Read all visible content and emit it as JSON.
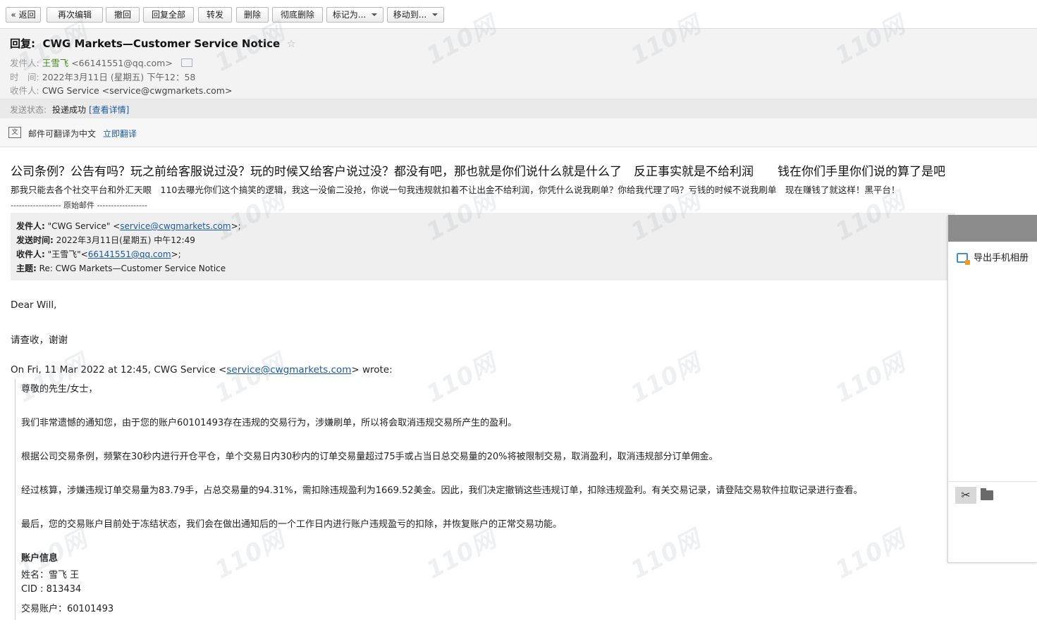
{
  "toolbar": {
    "back": "« 返回",
    "edit_again": "再次编辑",
    "recall": "撤回",
    "reply_all": "回复全部",
    "forward": "转发",
    "delete": "删除",
    "delete_permanent": "彻底删除",
    "mark_as": "标记为...",
    "move_to": "移动到..."
  },
  "header": {
    "reply_prefix": "回复:",
    "subject": "CWG Markets—Customer Service Notice",
    "star": "☆",
    "sender_label": "发件人:",
    "sender_name": "王雪飞",
    "sender_email": "<66141551@qq.com>",
    "time_label": "时　间:",
    "time_value": "2022年3月11日 (星期五) 下午12：58",
    "to_label": "收件人:",
    "to_value": "CWG Service <service@cwgmarkets.com>",
    "status_label": "发送状态:",
    "status_value": "投递成功",
    "status_link": "[查看详情]",
    "translate_text": "邮件可翻译为中文",
    "translate_link": "立即翻译"
  },
  "body": {
    "line1": "公司条例？公告有吗？玩之前给客服说过没？玩的时候又给客户说过没？都没有吧，那也就是你们说什么就是什么了　反正事实就是不给利润　　钱在你们手里你们说的算了是吧",
    "line2": "那我只能去各个社交平台和外汇天眼　110去曝光你们这个搞笑的逻辑，我这一没偷二没抢，你说一句我违规就扣着不让出金不给利润，你凭什么说我刷单？你给我代理了吗？亏钱的时候不说我刷单　现在赚钱了就这样！黑平台！",
    "orig_sep": "------------------ 原始邮件 ------------------",
    "quote": {
      "from_label": "发件人:",
      "from_name": "\"CWG Service\" <",
      "from_email": "service@cwgmarkets.com",
      "from_end": ">;",
      "time_label": "发送时间:",
      "time_value": "2022年3月11日(星期五) 中午12:49",
      "to_label": "收件人:",
      "to_name": "\"王雪飞\"<",
      "to_email": "66141551@qq.com",
      "to_end": ">;",
      "subject_label": "主题:",
      "subject_value": "Re: CWG Markets—Customer Service Notice"
    },
    "greeting": "Dear Will,",
    "please_check": "请查收，谢谢",
    "wrote_prefix": "On Fri, 11 Mar 2022 at 12:45, CWG Service <",
    "wrote_email": "service@cwgmarkets.com",
    "wrote_suffix": "> wrote:",
    "p_salutation": "尊敬的先生/女士，",
    "p1": "我们非常遗憾的通知您，由于您的账户60101493存在违规的交易行为，涉嫌刷单，所以将会取消违规交易所产生的盈利。",
    "p2": "根据公司交易条例，频繁在30秒内进行开仓平仓，单个交易日内30秒内的订单交易量超过75手或占当日总交易量的20%将被限制交易，取消盈利，取消违规部分订单佣金。",
    "p3": "经过核算，涉嫌违规订单交易量为83.79手，占总交易量的94.31%，需扣除违规盈利为1669.52美金。因此，我们决定撤销这些违规订单，扣除违规盈利。有关交易记录，请登陆交易软件拉取记录进行查看。",
    "p4": "最后，您的交易账户目前处于冻结状态，我们会在做出通知后的一个工作日内进行账户违规盈亏的扣除，并恢复账户的正常交易功能。",
    "account_title": "账户信息",
    "name_line": "姓名：雪飞 王",
    "cid_line": "CID : 813434",
    "acct_line": "交易账户：60101493"
  },
  "popup": {
    "export_album": "导出手机相册",
    "icons": [
      "album-icon",
      "scissors-icon",
      "folder-icon"
    ]
  },
  "watermark": "110网"
}
